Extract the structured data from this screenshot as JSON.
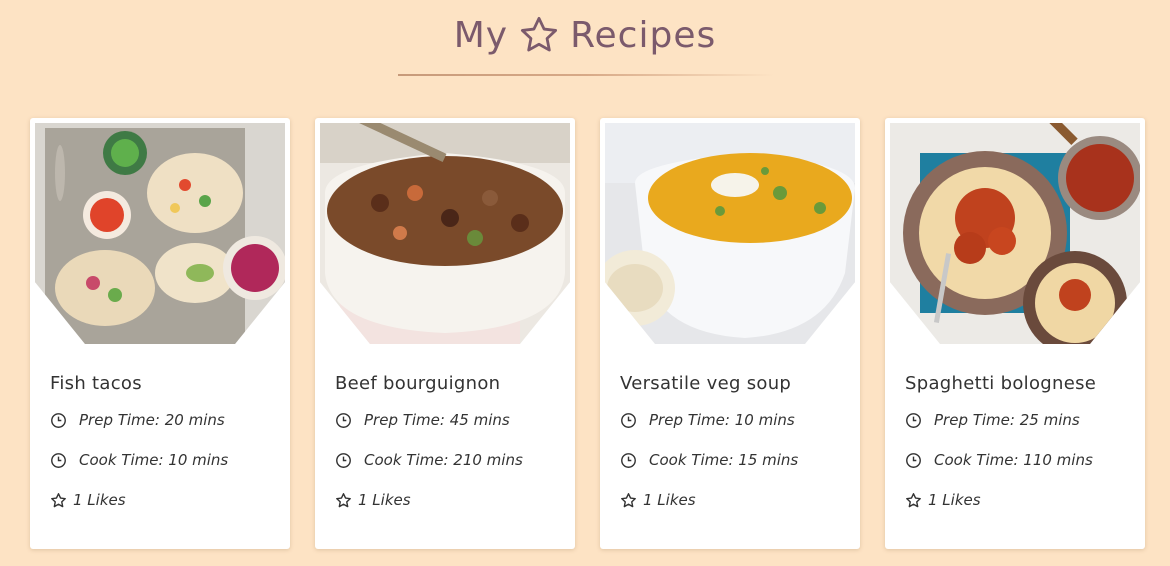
{
  "header": {
    "title_left": "My",
    "title_right": "Recipes",
    "title_icon": "star-outline-icon"
  },
  "colors": {
    "background": "#fde3c4",
    "title": "#7b5a6c",
    "card": "#ffffff",
    "text": "#333333"
  },
  "recipes": [
    {
      "name": "Fish tacos",
      "prep": "Prep Time: 20 mins",
      "cook": "Cook Time: 10 mins",
      "likes": "1 Likes",
      "image": "fish-tacos-photo"
    },
    {
      "name": "Beef bourguignon",
      "prep": "Prep Time: 45 mins",
      "cook": "Cook Time: 210 mins",
      "likes": "1 Likes",
      "image": "beef-bourguignon-photo"
    },
    {
      "name": "Versatile veg soup",
      "prep": "Prep Time: 10 mins",
      "cook": "Cook Time: 15 mins",
      "likes": "1 Likes",
      "image": "veg-soup-photo"
    },
    {
      "name": "Spaghetti bolognese",
      "prep": "Prep Time: 25 mins",
      "cook": "Cook Time: 110 mins",
      "likes": "1 Likes",
      "image": "spaghetti-bolognese-photo"
    }
  ]
}
